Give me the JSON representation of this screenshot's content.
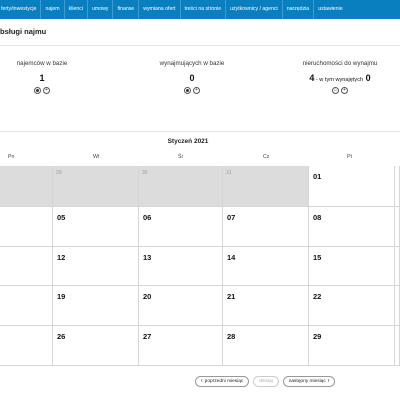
{
  "nav": {
    "items": [
      "ferty/inwestycje",
      "najem",
      "klienci",
      "umowy",
      "finanse",
      "wymiana ofert",
      "treści na stronie",
      "użytkownicy / agenci",
      "narzędzia",
      "ustawienie"
    ]
  },
  "page": {
    "title": "bsługi najmu"
  },
  "stats": {
    "tenants": {
      "label": "najemców w bazie",
      "value": "1"
    },
    "landlords": {
      "label": "wynajmujących w bazie",
      "value": "0"
    },
    "properties": {
      "label": "nieruchomości do wynajmu",
      "value": "4",
      "sub_label": " - w tym wynajętych",
      "sub_value": "0"
    }
  },
  "calendar": {
    "month": "Styczeń 2021",
    "weekdays": [
      "Pn",
      "Wt",
      "Śr",
      "Cz",
      "Pt"
    ],
    "rows": [
      [
        "",
        "29",
        "30",
        "31",
        "01",
        ""
      ],
      [
        "",
        "05",
        "06",
        "07",
        "08",
        ""
      ],
      [
        "",
        "12",
        "13",
        "14",
        "15",
        ""
      ],
      [
        "",
        "19",
        "20",
        "21",
        "22",
        ""
      ],
      [
        "",
        "26",
        "27",
        "28",
        "29",
        ""
      ]
    ]
  },
  "pager": {
    "prev": "poprzedni miesiąc",
    "today": "dzisiaj",
    "next": "następny miesiąc"
  },
  "colors": {
    "nav_bg": "#0a7fbf",
    "other_month_bg": "#dcdcdc"
  }
}
